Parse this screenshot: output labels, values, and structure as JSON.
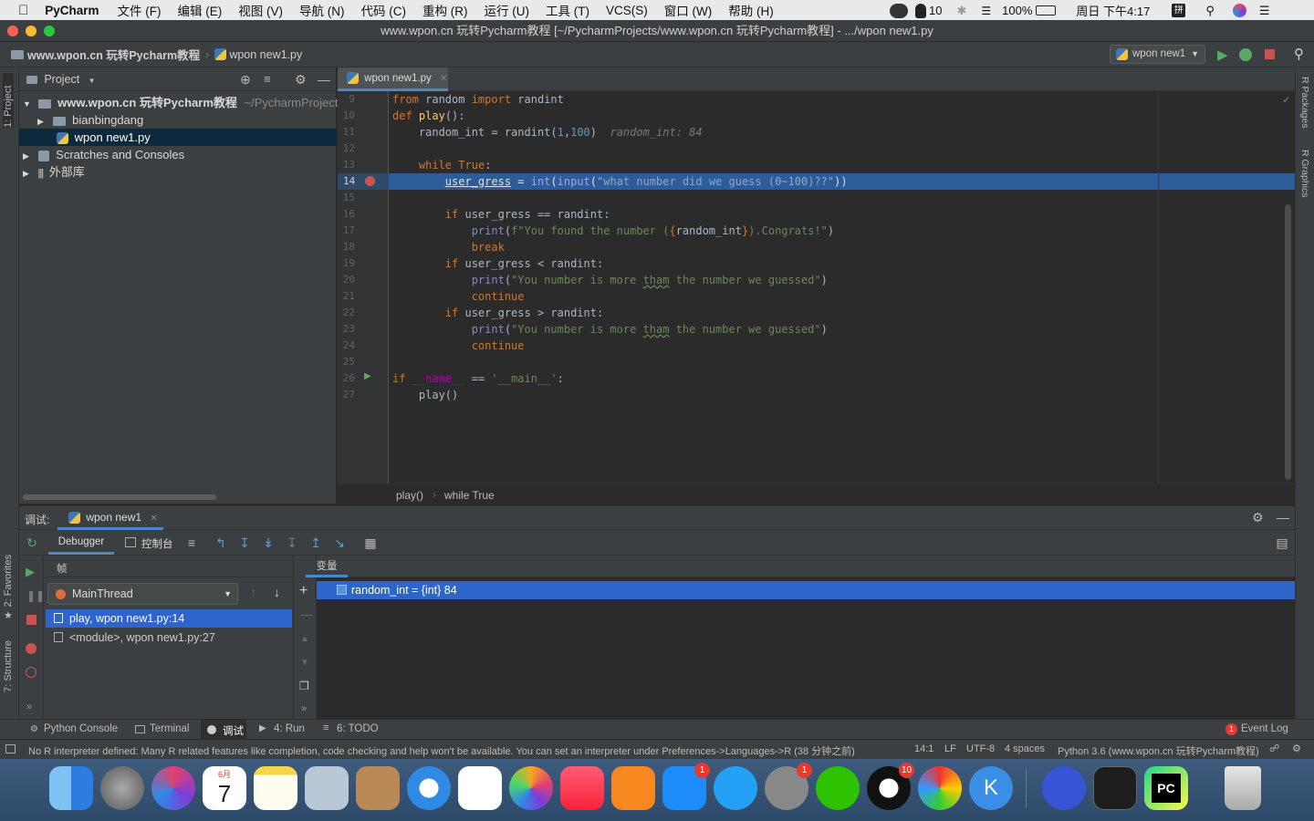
{
  "menubar": {
    "app": "PyCharm",
    "items": [
      "文件 (F)",
      "编辑 (E)",
      "视图 (V)",
      "导航 (N)",
      "代码 (C)",
      "重构 (R)",
      "运行 (U)",
      "工具 (T)",
      "VCS(S)",
      "窗口 (W)",
      "帮助 (H)"
    ],
    "qq_count": "10",
    "battery": "100%",
    "clock": "周日 下午4:17"
  },
  "window": {
    "title": "www.wpon.cn 玩转Pycharm教程 [~/PycharmProjects/www.wpon.cn 玩转Pycharm教程] - .../wpon new1.py"
  },
  "navbar": {
    "project": "www.wpon.cn 玩转Pycharm教程",
    "file": "wpon new1.py",
    "run_config": "wpon new1"
  },
  "sidestrip": {
    "project": "1: Project",
    "favorites": "2: Favorites",
    "structure": "7: Structure",
    "r_packages": "R Packages",
    "r_graphics": "R Graphics"
  },
  "project_panel": {
    "title": "Project",
    "root": "www.wpon.cn 玩转Pycharm教程",
    "root_path": "~/PycharmProject",
    "folder": "bianbingdang",
    "file": "wpon new1.py",
    "scratches": "Scratches and Consoles",
    "external": "外部库"
  },
  "editor": {
    "tab": "wpon new1.py",
    "line_numbers": [
      "9",
      "10",
      "11",
      "12",
      "13",
      "14",
      "15",
      "16",
      "17",
      "18",
      "19",
      "20",
      "21",
      "22",
      "23",
      "24",
      "25",
      "26",
      "27"
    ],
    "hint": "random_int: 84",
    "breadcrumb": [
      "play()",
      "while True"
    ]
  },
  "debug": {
    "label": "调试:",
    "tab": "wpon new1",
    "debugger_tab": "Debugger",
    "console_tab": "控制台",
    "frames_header": "帧",
    "vars_header": "变量",
    "thread": "MainThread",
    "frames": [
      "play, wpon new1.py:14",
      "<module>, wpon new1.py:27"
    ],
    "variable": "random_int = {int} 84"
  },
  "bottom_tabs": [
    "Python Console",
    "Terminal",
    "调试",
    "4: Run",
    "6: TODO"
  ],
  "event_log": "Event Log",
  "event_count": "1",
  "status": {
    "message": "No R interpreter defined: Many R related features like completion, code checking and help won't be available. You can set an interpreter under Preferences->Languages->R (38 分钟之前)",
    "position": "14:1",
    "line_sep": "LF",
    "encoding": "UTF-8",
    "indent": "4 spaces",
    "interpreter": "Python 3.6 (www.wpon.cn 玩转Pycharm教程)"
  },
  "dock": {
    "calendar_month": "6月",
    "calendar_day": "7",
    "badges": [
      "1",
      "1",
      "10",
      "1"
    ]
  }
}
